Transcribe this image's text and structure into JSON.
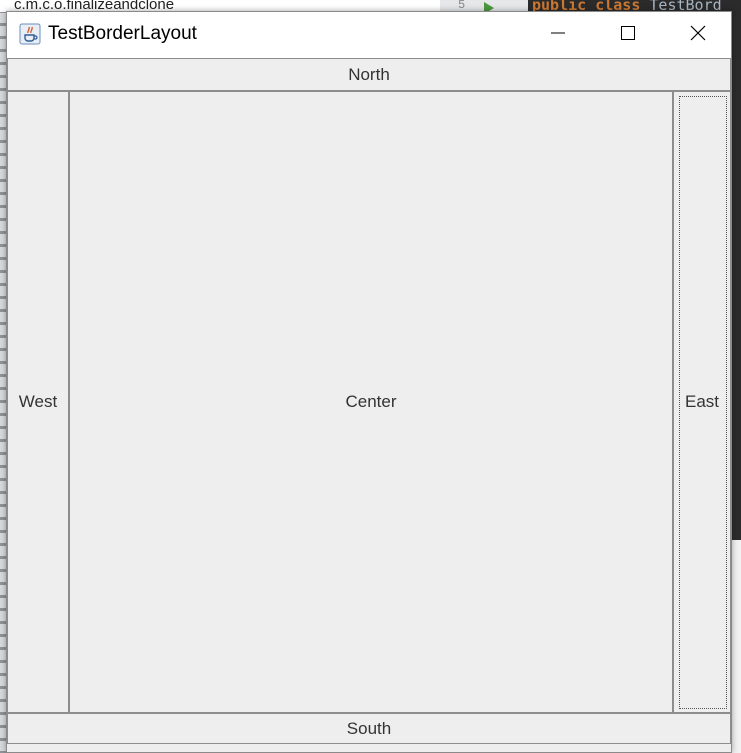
{
  "background": {
    "breadcrumb": "c.m.c.o.finalizeandclone",
    "gutter_line_number": "5",
    "editor_code": "public class TestBord"
  },
  "window": {
    "title": "TestBorderLayout",
    "icon": "java-coffee-cup-icon",
    "controls": {
      "minimize": "minimize-icon",
      "maximize": "maximize-icon",
      "close": "close-icon"
    }
  },
  "layout_buttons": {
    "north": "North",
    "west": "West",
    "center": "Center",
    "east": "East",
    "south": "South"
  },
  "colors": {
    "window_bg": "#eeeeee",
    "titlebar_bg": "#ffffff",
    "button_border": "#8d8d8d",
    "editor_bg": "#2b2b2b",
    "editor_keyword": "#cc7832"
  }
}
